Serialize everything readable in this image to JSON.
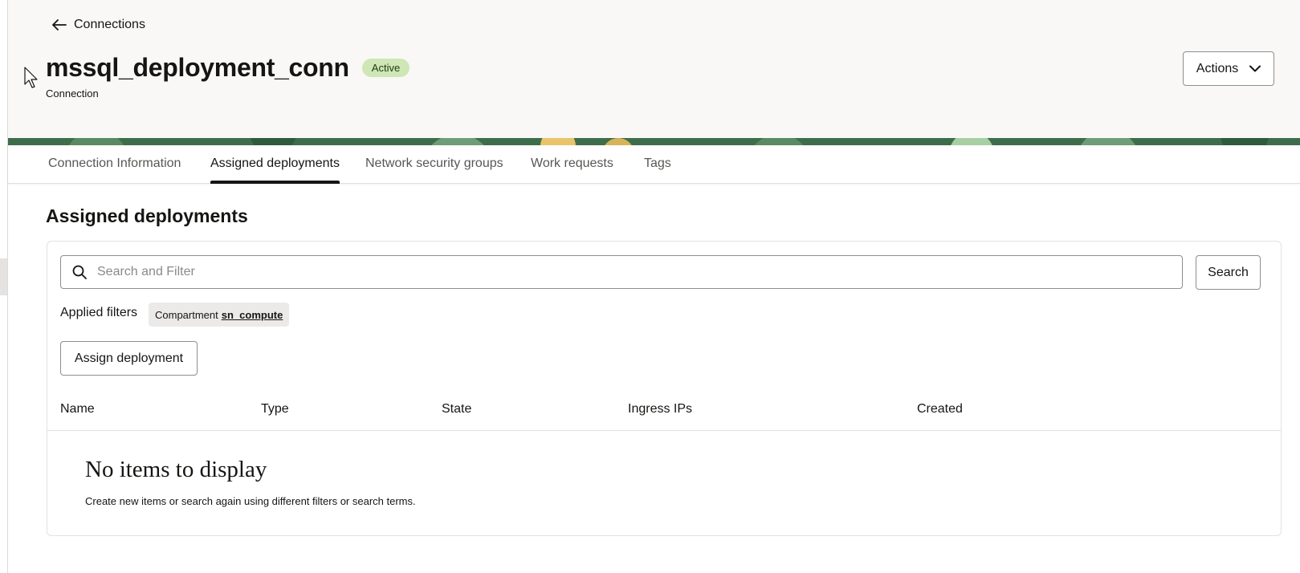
{
  "breadcrumb": {
    "back_label": "Connections"
  },
  "header": {
    "title": "mssql_deployment_conn",
    "status": "Active",
    "subtitle": "Connection",
    "actions_label": "Actions"
  },
  "tabs": [
    {
      "label": "Connection Information",
      "active": false
    },
    {
      "label": "Assigned deployments",
      "active": true
    },
    {
      "label": "Network security groups",
      "active": false
    },
    {
      "label": "Work requests",
      "active": false
    },
    {
      "label": "Tags",
      "active": false
    }
  ],
  "section": {
    "title": "Assigned deployments",
    "search": {
      "placeholder": "Search and Filter",
      "value": "",
      "button_label": "Search"
    },
    "applied_filters": {
      "label": "Applied filters",
      "chip_key": "Compartment",
      "chip_value": "sn_compute"
    },
    "assign_button_label": "Assign deployment",
    "table": {
      "columns": [
        "Name",
        "Type",
        "State",
        "Ingress IPs",
        "Created"
      ],
      "rows": []
    },
    "empty_state": {
      "title": "No items to display",
      "description": "Create new items or search again using different filters or search terms."
    }
  },
  "icons": {
    "back": "arrow-left-icon",
    "actions": "chevron-down-icon",
    "search": "search-icon",
    "cursor": "mouse-pointer-icon"
  },
  "colors": {
    "header_bg": "#f9f8f6",
    "badge_bg": "#cfe6b5",
    "banner_green": "#3e6d4b",
    "text": "#161513"
  }
}
